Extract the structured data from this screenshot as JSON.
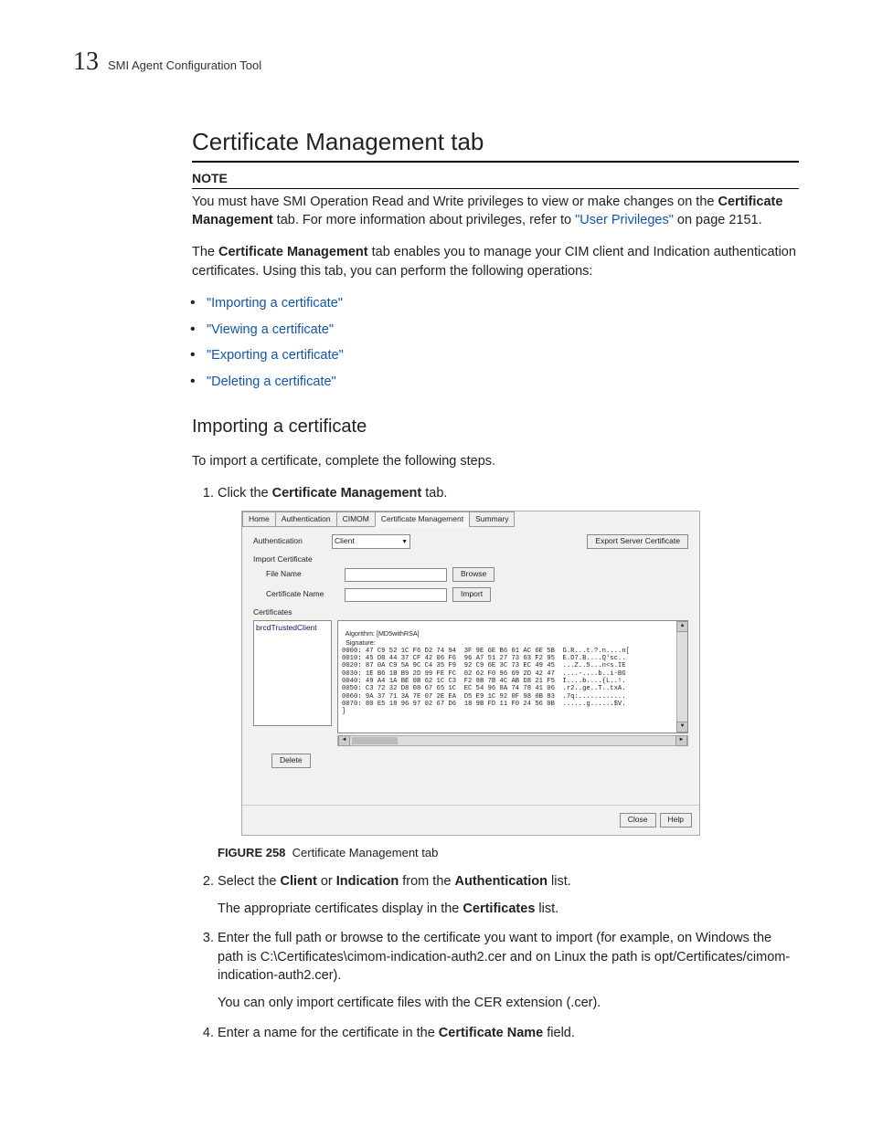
{
  "header": {
    "chapter_number": "13",
    "chapter_title": "SMI Agent Configuration Tool"
  },
  "h1": "Certificate Management tab",
  "note": {
    "label": "NOTE",
    "pre": "You must have SMI Operation Read and Write privileges to view or make changes on the ",
    "bold1": "Certificate Management",
    "mid": " tab. For more information about privileges, refer to ",
    "link": "\"User Privileges\"",
    "post": " on page 2151."
  },
  "intro": {
    "pre": "The ",
    "bold": "Certificate Management",
    "post": " tab enables you to manage your CIM client and Indication authentication certificates. Using this tab, you can perform the following operations:"
  },
  "bullets": [
    "\"Importing a certificate\"",
    "\"Viewing a certificate\"",
    "\"Exporting a certificate\"",
    "\"Deleting a certificate\""
  ],
  "h2": "Importing a certificate",
  "lead": "To import a certificate, complete the following steps.",
  "steps": {
    "s1": {
      "pre": "Click the ",
      "bold": "Certificate Management",
      "post": " tab."
    },
    "s2": {
      "pre": "Select the ",
      "b1": "Client",
      "mid1": " or ",
      "b2": "Indication",
      "mid2": " from the ",
      "b3": "Authentication",
      "post": " list.",
      "sub_pre": "The appropriate certificates display in the ",
      "sub_b": "Certificates",
      "sub_post": " list."
    },
    "s3": {
      "text": "Enter the full path or browse to the certificate you want to import (for example, on Windows the path is C:\\Certificates\\cimom-indication-auth2.cer and on Linux the path is opt/Certificates/cimom-indication-auth2.cer).",
      "sub": "You can only import certificate files with the CER extension (.cer)."
    },
    "s4": {
      "pre": "Enter a name for the certificate in the ",
      "bold": "Certificate Name",
      "post": " field."
    }
  },
  "figure": {
    "label": "FIGURE 258",
    "caption": "Certificate Management tab"
  },
  "app": {
    "tabs": [
      "Home",
      "Authentication",
      "CIMOM",
      "Certificate Management",
      "Summary"
    ],
    "auth_label": "Authentication",
    "auth_value": "Client",
    "export_btn": "Export Server Certificate",
    "import_section": "Import Certificate",
    "filename_label": "File Name",
    "browse_btn": "Browse",
    "certname_label": "Certificate Name",
    "import_btn": "Import",
    "certs_section": "Certificates",
    "list_item": "brcdTrustedClient",
    "hex_top": "  Algorithm: [MD5withRSA]",
    "hex_sig": "  Signature:",
    "hex_lines": [
      "0000: 47 C9 52 1C F6 D2 74 94  3F 9E 6E B6 01 AC 6E 5B  G.R...t.?.n....n[",
      "0010: 45 D8 44 37 CF 42 06 F6  96 A7 51 27 73 63 F2 95  E.D7.B....Q'sc..",
      "0020: 87 0A C9 5A 9C C4 35 F9  92 C9 6E 3C 73 EC 49 45  ...Z..5...n<s.IE",
      "0030: 1E B6 1B B9 2D 99 FE FC  02 62 F0 96 69 2D 42 47  ....-....b..i-BG",
      "0040: 49 A4 1A BE 0B 62 1C C3  F2 8B 7B 4C AB D8 21 F5  I....b....{L..!.",
      "0050: C3 72 32 D8 08 67 65 1C  EC 54 96 8A 74 78 41 06  .r2..ge..T..txA.",
      "0060: 9A 37 71 3A 7E 07 2E EA  D5 E9 1C 92 0F 98 0B 83  .7q:............",
      "0070: 80 E5 18 96 97 02 67 D6  18 9B FD 11 F0 24 56 0B  ......g......$V."
    ],
    "delete_btn": "Delete",
    "close_btn": "Close",
    "help_btn": "Help"
  }
}
